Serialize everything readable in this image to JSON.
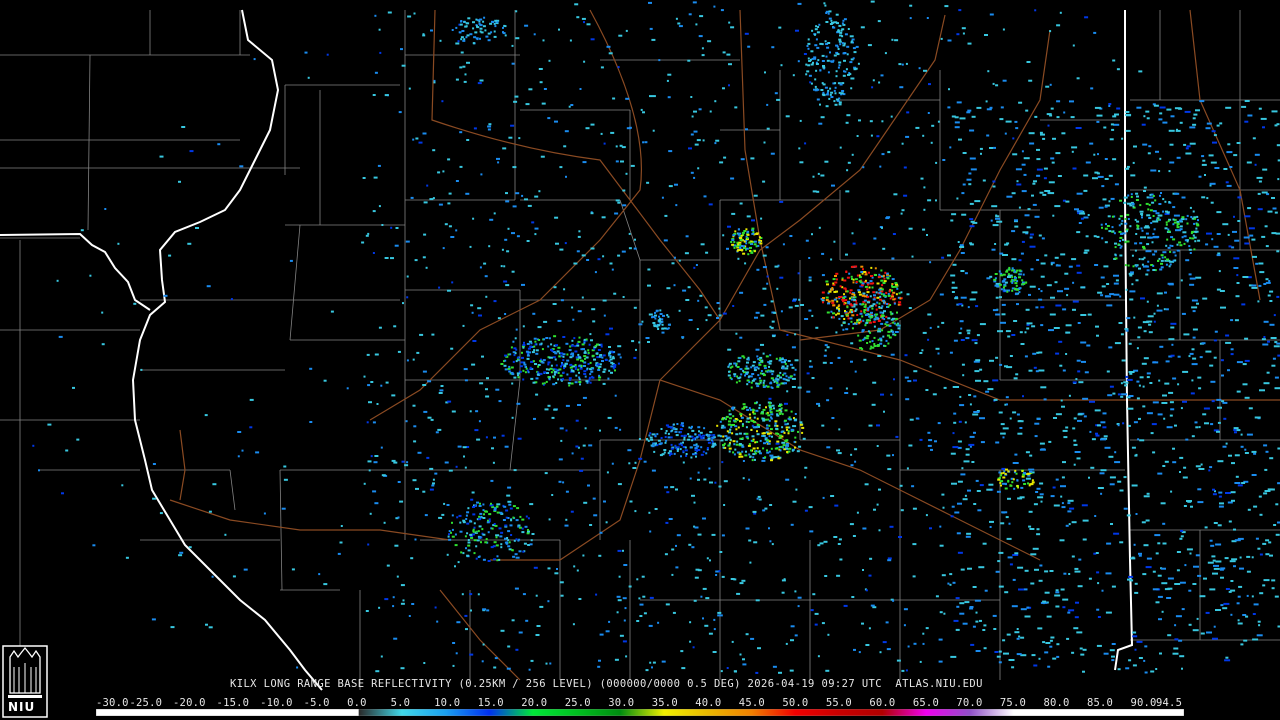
{
  "product": {
    "title": "KILX LONG RANGE BASE REFLECTIVITY (0.25KM / 256 LEVEL) (000000/0000 0.5 DEG) 2026-04-19 09:27 UTC  ATLAS.NIU.EDU"
  },
  "logo": {
    "text": "NIU"
  },
  "colorbar": {
    "labels": [
      "-30.0",
      "-25.0",
      "-20.0",
      "-15.0",
      "-10.0",
      "-5.0",
      "0.0",
      "5.0",
      "10.0",
      "15.0",
      "20.0",
      "25.0",
      "30.0",
      "35.0",
      "40.0",
      "45.0",
      "50.0",
      "55.0",
      "60.0",
      "65.0",
      "70.0",
      "75.0",
      "80.0",
      "85.0",
      "90.0",
      "94.5"
    ],
    "stops": [
      {
        "dbz": -30,
        "color": "#ffffff"
      },
      {
        "dbz": 0,
        "color": "#ffffff"
      },
      {
        "dbz": 0.1,
        "color": "#2a2a2a"
      },
      {
        "dbz": 5,
        "color": "#40d8e8"
      },
      {
        "dbz": 10,
        "color": "#1aa0f0"
      },
      {
        "dbz": 15,
        "color": "#0030f0"
      },
      {
        "dbz": 20,
        "color": "#00e838"
      },
      {
        "dbz": 25,
        "color": "#00c020"
      },
      {
        "dbz": 30,
        "color": "#008c10"
      },
      {
        "dbz": 35,
        "color": "#f0f000"
      },
      {
        "dbz": 40,
        "color": "#e8b800"
      },
      {
        "dbz": 45,
        "color": "#f08000"
      },
      {
        "dbz": 50,
        "color": "#f00000"
      },
      {
        "dbz": 55,
        "color": "#c80000"
      },
      {
        "dbz": 60,
        "color": "#b00000"
      },
      {
        "dbz": 65,
        "color": "#f000f0"
      },
      {
        "dbz": 70,
        "color": "#9050c8"
      },
      {
        "dbz": 75,
        "color": "#ffffff"
      },
      {
        "dbz": 94.5,
        "color": "#ffffff"
      }
    ]
  },
  "map_colors": {
    "background": "#000000",
    "state_border": "#ffffff",
    "county_border": "#9a9a9a",
    "highway": "#8a4a22"
  },
  "echo_colors": {
    "light": "#38c8e0",
    "medium": "#1a8cf0",
    "strong": "#0038e8",
    "green": "#30e030",
    "yellow": "#e8e800",
    "orange": "#f09000",
    "red": "#f01010"
  }
}
